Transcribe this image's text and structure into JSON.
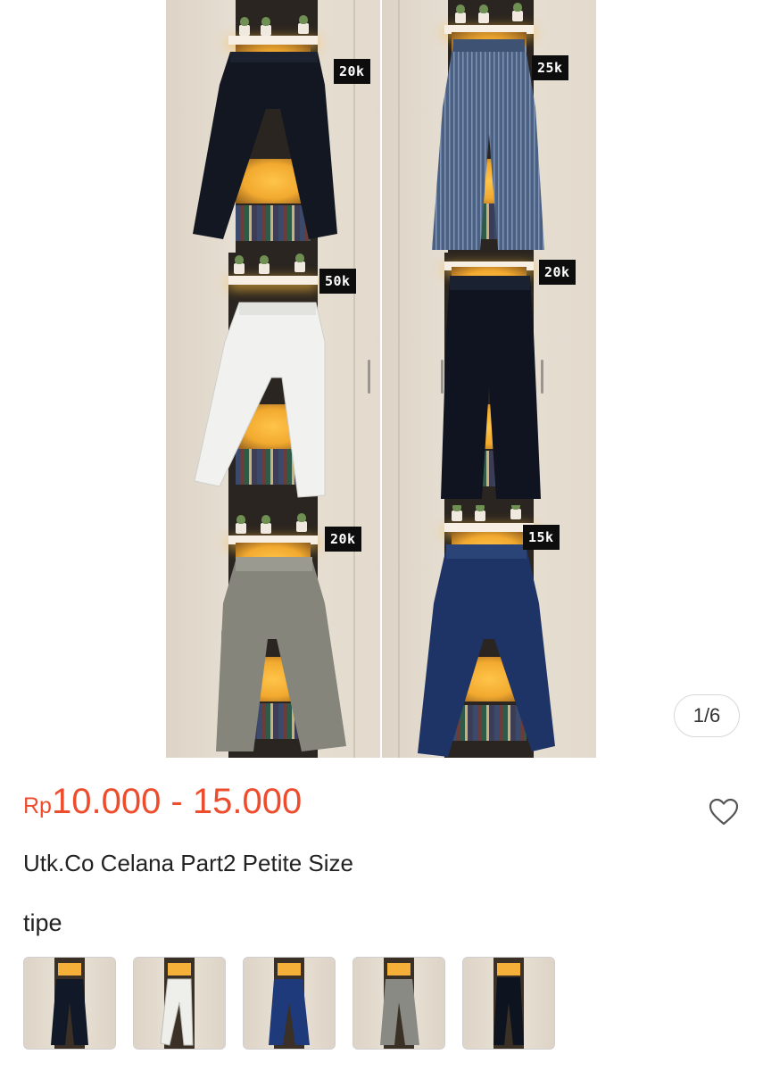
{
  "gallery": {
    "panels": [
      {
        "price_tag": "20k",
        "pants_color": "#121722",
        "style": "dark-navy"
      },
      {
        "price_tag": "25k",
        "pants_color": "#4b6184",
        "style": "striped-blue"
      },
      {
        "price_tag": "50k",
        "pants_color": "#f1f1ef",
        "style": "white-skinny"
      },
      {
        "price_tag": "20k",
        "pants_color": "#0f1420",
        "style": "dark-wide"
      },
      {
        "price_tag": "20k",
        "pants_color": "#85857c",
        "style": "grey-wide"
      },
      {
        "price_tag": "15k",
        "pants_color": "#1e3466",
        "style": "navy-jogger"
      }
    ],
    "counter": "1/6"
  },
  "product": {
    "currency": "Rp",
    "price_range": "10.000 - 15.000",
    "title": "Utk.Co Celana Part2 Petite Size",
    "price_color": "#ee4d2d"
  },
  "variants": {
    "label": "tipe",
    "items": [
      {
        "color": "#111827",
        "icon": "navy-pants-thumbnail"
      },
      {
        "color": "#eeeeea",
        "icon": "white-pants-thumbnail"
      },
      {
        "color": "#1f3a7a",
        "icon": "blue-pants-thumbnail"
      },
      {
        "color": "#8a8a84",
        "icon": "grey-pants-thumbnail"
      },
      {
        "color": "#0e1320",
        "icon": "black-pants-thumbnail"
      }
    ]
  },
  "icons": {
    "heart": "heart-icon"
  }
}
